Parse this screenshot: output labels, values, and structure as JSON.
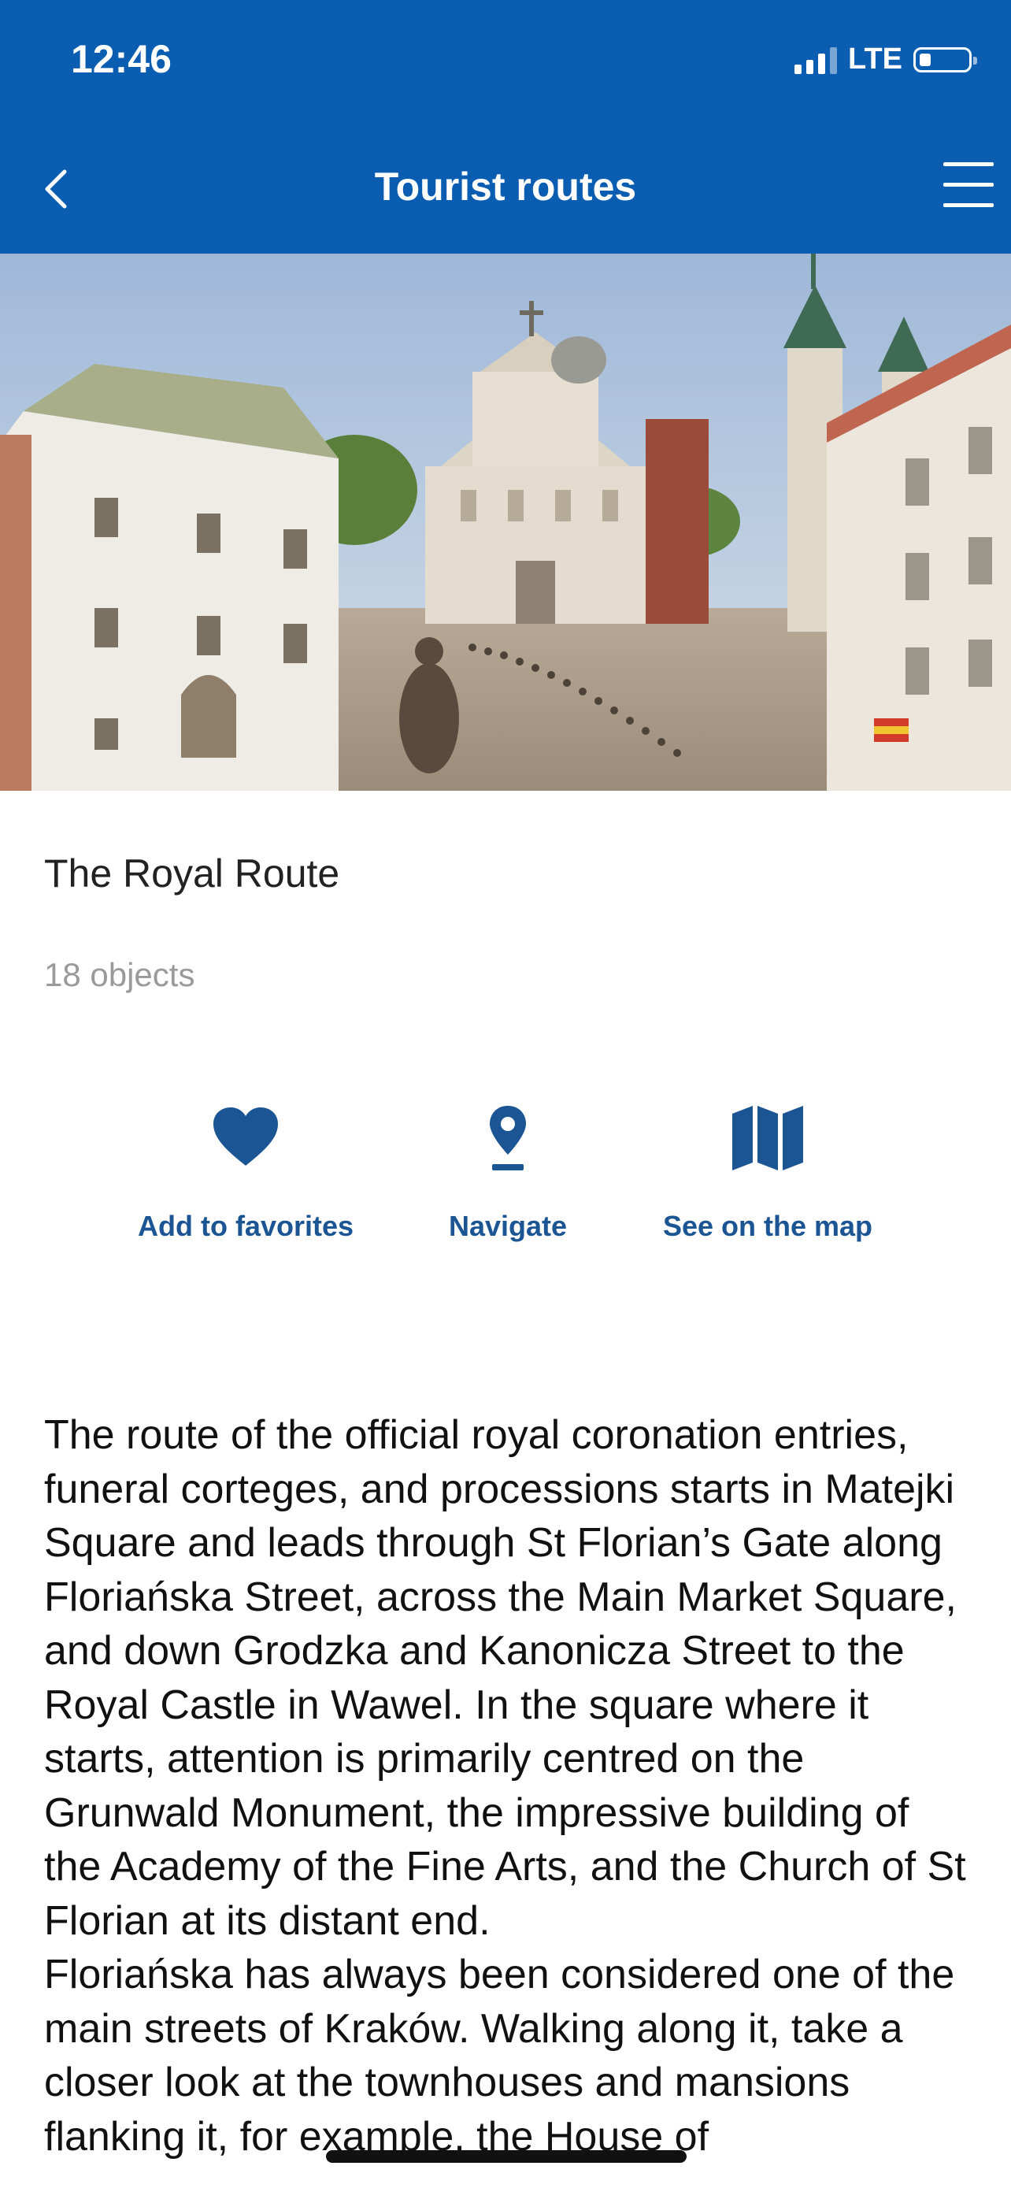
{
  "status": {
    "time": "12:46",
    "network": "LTE"
  },
  "nav": {
    "title": "Tourist routes",
    "back_icon": "chevron-left-icon",
    "menu_icon": "hamburger-menu-icon"
  },
  "route": {
    "title": "The Royal Route",
    "count": "18 objects"
  },
  "actions": {
    "favorites": {
      "label": "Add to favorites",
      "icon": "heart-icon"
    },
    "navigate": {
      "label": "Navigate",
      "icon": "location-pin-icon"
    },
    "map": {
      "label": "See on the map",
      "icon": "map-icon"
    }
  },
  "description": {
    "paragraph1": "The route of the official royal coronation entries, funeral corteges, and processions starts in Matejki Square and leads through St Florian’s Gate along Floriańska Street, across the Main Market Square, and down Grodzka and Kanonicza Street to the Royal Castle in Wawel. In the square where it starts, attention is primarily centred on the Grunwald Monument, the impressive building of the Academy of the Fine Arts, and the Church of St Florian at its distant end.",
    "paragraph2": "Floriańska has always been considered one of the main streets of Kraków. Walking along it, take a closer look at the townhouses and mansions flanking it, for example, the House of"
  },
  "colors": {
    "header": "#0b5db1",
    "accent": "#1b5593"
  }
}
